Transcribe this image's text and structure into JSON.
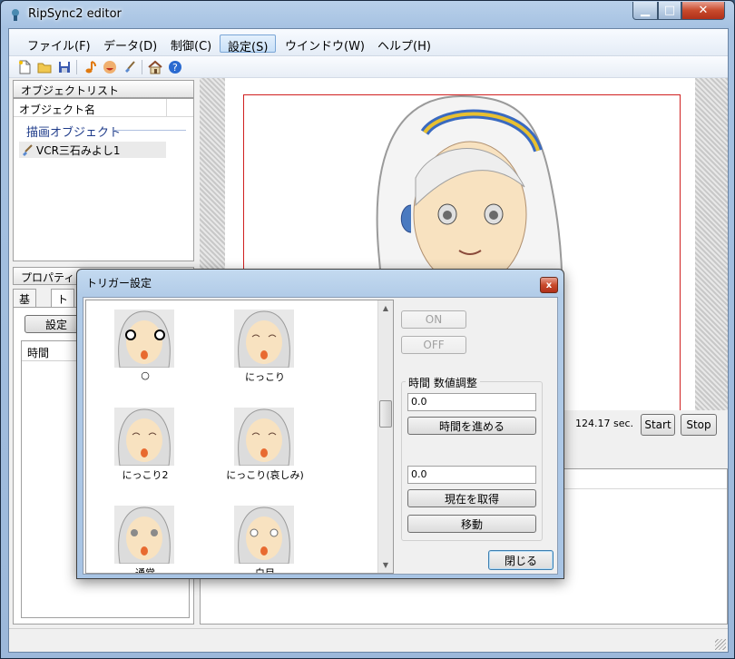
{
  "window": {
    "title": "RipSync2 editor"
  },
  "menu": [
    "ファイル(F)",
    "データ(D)",
    "制御(C)",
    "設定(S)",
    "ウインドウ(W)",
    "ヘルプ(H)"
  ],
  "object_panel": {
    "header": "オブジェクトリスト",
    "column": "オブジェクト名",
    "group": "描画オブジェクト",
    "item": "VCR三石みよし1"
  },
  "props_panel": {
    "header": "プロパティ",
    "tabs": [
      "基本",
      "トリガ"
    ],
    "set_button": "設定",
    "time_column": "時間"
  },
  "playback": {
    "time": "124.17 sec.",
    "start": "Start",
    "stop": "Stop"
  },
  "dialog": {
    "title": "トリガー設定",
    "close_glyph": "x",
    "faces": [
      "○",
      "にっこり",
      "にっこり2",
      "にっこり(哀しみ)",
      "通常",
      "白目"
    ],
    "on_button": "ON",
    "off_button": "OFF",
    "group_label": "時間 数値調整",
    "value1": "0.0",
    "advance_button": "時間を進める",
    "value2": "0.0",
    "get_current_button": "現在を取得",
    "move_button": "移動",
    "close_button": "閉じる"
  },
  "icons": {
    "toolbar": [
      "new-file-icon",
      "open-folder-icon",
      "save-icon",
      "music-note-icon",
      "mouth-icon",
      "brush-icon",
      "home-icon",
      "help-icon"
    ]
  }
}
